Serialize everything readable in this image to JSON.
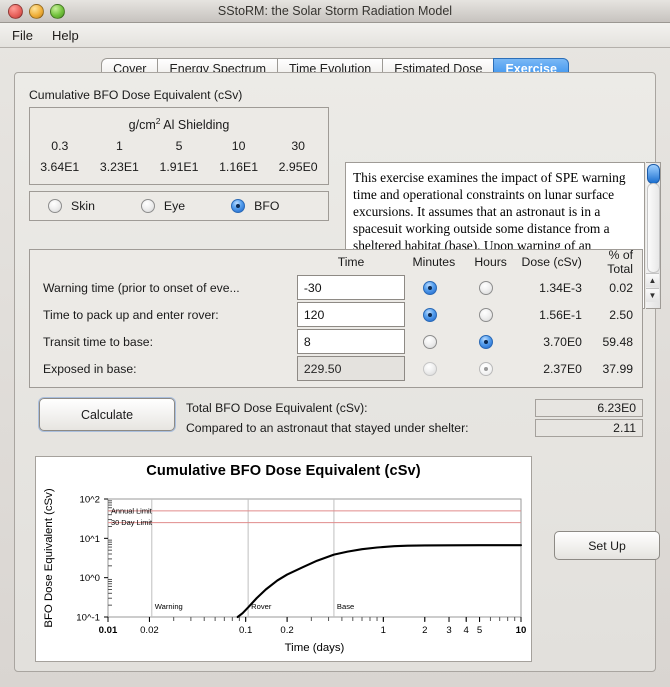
{
  "window": {
    "title": "SStoRM: the Solar Storm Radiation Model",
    "controls": {
      "close": "close",
      "minimize": "minimize",
      "zoom": "zoom"
    }
  },
  "menubar": {
    "items": [
      {
        "label": "File"
      },
      {
        "label": "Help"
      }
    ]
  },
  "tabs": [
    {
      "label": "Cover",
      "active": false
    },
    {
      "label": "Energy Spectrum",
      "active": false
    },
    {
      "label": "Time Evolution",
      "active": false
    },
    {
      "label": "Estimated Dose",
      "active": false
    },
    {
      "label": "Exercise",
      "active": true
    }
  ],
  "shielding_panel": {
    "caption": "Cumulative BFO Dose Equivalent (cSv)",
    "header": "g/cm",
    "header_sup": "2",
    "header_rest": " Al Shielding",
    "thicknesses": [
      "0.3",
      "1",
      "5",
      "10",
      "30"
    ],
    "doses": [
      "3.64E1",
      "3.23E1",
      "1.91E1",
      "1.16E1",
      "2.95E0"
    ]
  },
  "organ_selector": {
    "options": [
      {
        "label": "Skin",
        "selected": false
      },
      {
        "label": "Eye",
        "selected": false
      },
      {
        "label": "BFO",
        "selected": true
      }
    ]
  },
  "description": {
    "text": "This exercise examines the impact of SPE warning time and operational constraints on lunar surface excursions. It assumes that an astronaut is in a spacesuit working outside some distance from a sheltered habitat (base). Upon warning of an impending event, the astronaut will need some time to secure the equipment he/she is working with, and will then return to the base in a lightly",
    "scroll_up": "▲",
    "scroll_down": "▼"
  },
  "table": {
    "headers": {
      "label": "",
      "time": "Time",
      "minutes": "Minutes",
      "hours": "Hours",
      "dose": "Dose (cSv)",
      "percent": "% of Total"
    },
    "rows": [
      {
        "label": "Warning time (prior to onset of eve...",
        "time": "-30",
        "minutes_selected": true,
        "hours_selected": false,
        "disabled": false,
        "dose": "1.34E-3",
        "percent": "0.02"
      },
      {
        "label": "Time to pack up and enter rover:",
        "time": "120",
        "minutes_selected": true,
        "hours_selected": false,
        "disabled": false,
        "dose": "1.56E-1",
        "percent": "2.50"
      },
      {
        "label": "Transit time to base:",
        "time": "8",
        "minutes_selected": false,
        "hours_selected": true,
        "disabled": false,
        "dose": "3.70E0",
        "percent": "59.48"
      },
      {
        "label": "Exposed in base:",
        "time": "229.50",
        "minutes_selected": false,
        "hours_selected": true,
        "disabled": true,
        "dose": "2.37E0",
        "percent": "37.99"
      }
    ]
  },
  "actions": {
    "calculate_label": "Calculate",
    "setup_label": "Set Up"
  },
  "results": {
    "total_label": "Total BFO Dose Equivalent (cSv):",
    "total_value": "6.23E0",
    "compare_label": "Compared to an astronaut that stayed under shelter:",
    "compare_value": "2.11"
  },
  "chart_data": {
    "type": "line",
    "title": "Cumulative BFO Dose Equivalent (cSv)",
    "xlabel": "Time (days)",
    "ylabel": "BFO Dose Equivalent (cSv)",
    "xscale": "log",
    "yscale": "log",
    "xlim": [
      0.01,
      10
    ],
    "ylim": [
      0.1,
      100
    ],
    "xticks": [
      "0.01",
      "0.02",
      "0.1",
      "0.2",
      "1",
      "2",
      "3",
      "4",
      "5",
      "10"
    ],
    "xtick_values": [
      0.01,
      0.02,
      0.1,
      0.2,
      1,
      2,
      3,
      4,
      5,
      10
    ],
    "yticks": [
      "10^-1",
      "10^0",
      "10^1",
      "10^2"
    ],
    "ytick_values": [
      0.1,
      1,
      10,
      100
    ],
    "grid": false,
    "legend": "none",
    "reference_lines": [
      {
        "name": "Annual Limit",
        "value": 50,
        "color": "#e08b8b"
      },
      {
        "name": "30 Day Limit",
        "value": 25,
        "color": "#e08b8b"
      }
    ],
    "event_markers": [
      {
        "name": "Warning",
        "x": 0.0208,
        "color": "#bfbfbf"
      },
      {
        "name": "Rover",
        "x": 0.1042,
        "color": "#bfbfbf"
      },
      {
        "name": "Base",
        "x": 0.4375,
        "color": "#bfbfbf"
      }
    ],
    "series": [
      {
        "name": "Cumulative BFO Dose",
        "color": "#000000",
        "x": [
          0.0875,
          0.095,
          0.105,
          0.12,
          0.14,
          0.17,
          0.2,
          0.26,
          0.33,
          0.4375,
          0.55,
          0.7,
          0.9,
          1.2,
          1.5,
          2.0,
          3.0,
          5.0,
          7.0,
          10.0
        ],
        "y": [
          0.1,
          0.125,
          0.18,
          0.3,
          0.5,
          0.85,
          1.2,
          1.85,
          2.7,
          3.85,
          4.6,
          5.3,
          5.85,
          6.3,
          6.5,
          6.6,
          6.65,
          6.68,
          6.7,
          6.7
        ]
      }
    ]
  }
}
